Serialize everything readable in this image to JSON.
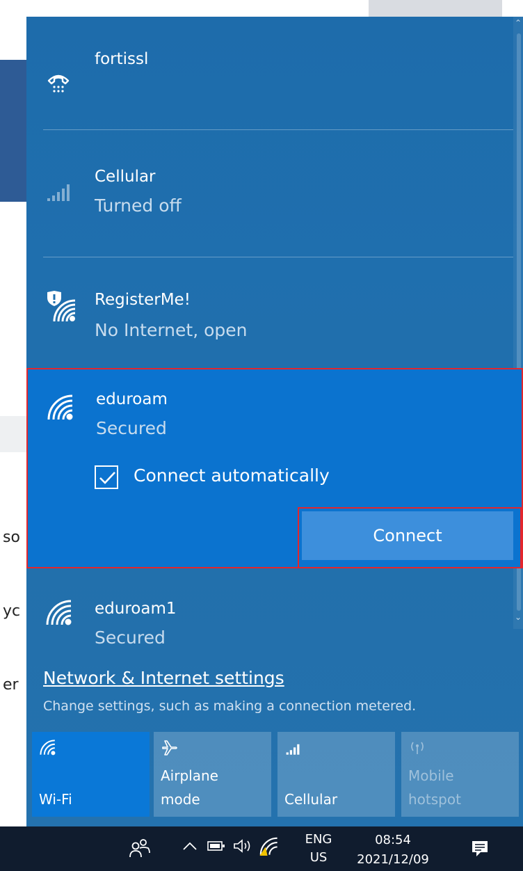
{
  "background": {
    "fragments": [
      "so",
      "yc",
      "er"
    ]
  },
  "networks": [
    {
      "name": "fortissl",
      "status": "",
      "icon": "dialup-icon"
    },
    {
      "name": "Cellular",
      "status": "Turned off",
      "icon": "cellular-signal-icon"
    },
    {
      "name": "RegisterMe!",
      "status": "No Internet, open",
      "icon": "wifi-shield-warning-icon"
    },
    {
      "name": "eduroam",
      "status": "Secured",
      "icon": "wifi-icon"
    },
    {
      "name": "eduroam1",
      "status": "Secured",
      "icon": "wifi-icon"
    }
  ],
  "selected_network": {
    "connect_automatically_label": "Connect automatically",
    "connect_automatically_checked": true,
    "connect_button_label": "Connect"
  },
  "settings": {
    "link_label": "Network & Internet settings",
    "description": "Change settings, such as making a connection metered."
  },
  "quick_actions": [
    {
      "label_line1": "",
      "label_line2": "Wi-Fi",
      "active": true,
      "icon": "wifi-icon"
    },
    {
      "label_line1": "Airplane",
      "label_line2": "mode",
      "active": false,
      "icon": "airplane-icon"
    },
    {
      "label_line1": "",
      "label_line2": "Cellular",
      "active": false,
      "icon": "cellular-signal-icon"
    },
    {
      "label_line1": "Mobile",
      "label_line2": "hotspot",
      "active": false,
      "disabled": true,
      "icon": "hotspot-icon"
    }
  ],
  "taskbar": {
    "language_line1": "ENG",
    "language_line2": "US",
    "time": "08:54",
    "date": "2021/12/09"
  },
  "colors": {
    "accent": "#0b73cf",
    "tile_active": "#0a78d7",
    "highlight_border": "#e3262d",
    "taskbar": "#101c2e"
  }
}
